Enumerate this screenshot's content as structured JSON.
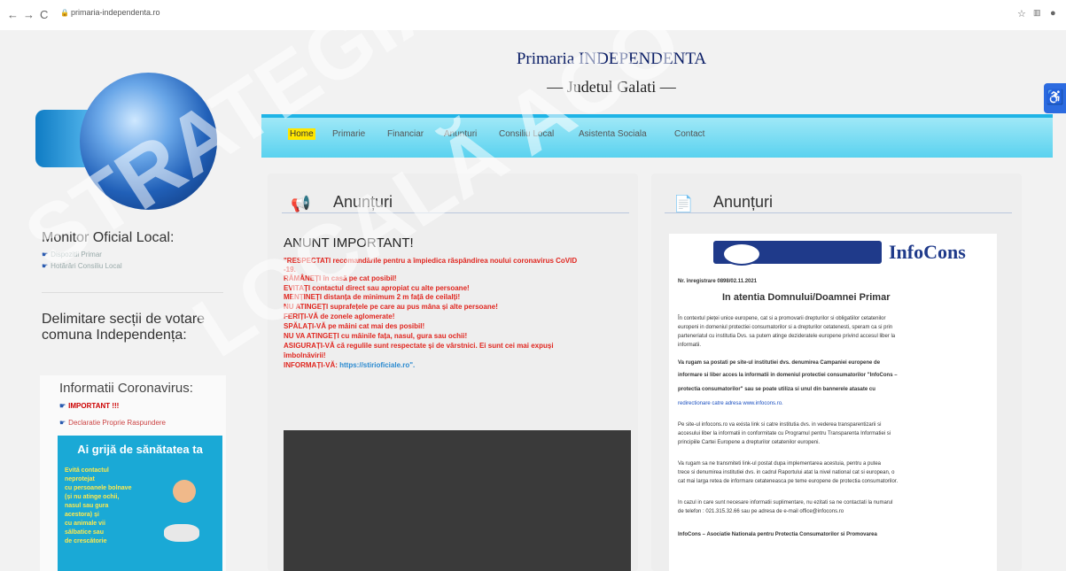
{
  "browser": {
    "url": "primaria-independenta.ro",
    "back": "←",
    "forward": "→",
    "reload": "C"
  },
  "header": {
    "title": "Primaria INDEPENDENTA",
    "subtitle": "–– Judetul Galati ––"
  },
  "nav": [
    "Home",
    "Primarie",
    "Financiar",
    "Anunturi",
    "Consiliu Local",
    "Asistenta Sociala",
    "Contact"
  ],
  "sidebar": {
    "monitor_title": "Monitor Oficial Local:",
    "monitor_links": [
      "Dispozitii Primar",
      "Hotărâri Consiliu Local"
    ],
    "vote_title_1": "Delimitare secții de votare",
    "vote_title_2": "comuna Independența:",
    "corona_title": "Informatii Coronavirus:",
    "corona_link1": "IMPORTANT !!!",
    "corona_link2": "Declaratie Proprie Raspundere",
    "health_title": "Ai grijă de sănătatea ta",
    "health_lines": [
      "Evită contactul",
      "neprotejat",
      "cu persoanele bolnave",
      "(și nu atinge ochii,",
      "nasul sau gura",
      "acestora) și",
      "cu animale vii",
      "sălbatice sau",
      "de crescătorie"
    ]
  },
  "panel_left": {
    "heading": "Anunțuri",
    "notice_title": "ANUNT IMPORTANT!",
    "lines": [
      "\"RESPECTATI recomandările pentru a împiedica răspândirea noului coronavirus CoVID",
      "-19.",
      "RĂMÂNEȚI în casă pe cat posibil!",
      "EVITAȚI contactul direct sau apropiat cu alte persoane!",
      "MENȚINEȚI distanța de minimum 2 m față de ceilalți!",
      "NU ATINGEȚI suprafețele pe care au pus mâna și alte persoane!",
      "FERIȚI-VĂ de zonele aglomerate!",
      "SPĂLAȚI-VĂ pe mâini cat mai des posibil!",
      "NU VA ATINGEȚI cu mâinile fața, nasul, gura sau ochii!",
      "ASIGURAȚI-VĂ că regulile sunt respectate și de vârstnici. Ei sunt cei mai expuși",
      "îmbolnăvirii!"
    ],
    "info_prefix": "INFORMAȚI-VĂ:",
    "info_link": "https://stirioficiale.ro\"."
  },
  "panel_right": {
    "heading": "Anunțuri",
    "doc_brand": "InfoCons",
    "doc_reg": "Nr. înregistrare 0898/02.11.2021",
    "doc_title": "In atentia Domnului/Doamnei Primar",
    "doc_paragraphs": [
      "În contextul pieței unice europene, cat si a promovarii drepturilor si obligatiilor cetatenilor",
      "europeni in domeniul protectiei consumatorilor si a drepturilor cetatenesti, speram ca si prin",
      "parteneriatul cu institutia Dvs. sa putem atinge dezideratele europene privind accesul liber la",
      "informatii.",
      "Va rugam sa postati pe site-ul institutiei dvs. denumirea Campaniei europene de",
      "informare si liber acces la informatii in domeniul protectiei consumatorilor \"InfoCons –",
      "protectia consumatorilor\" sau se poate utiliza si unul din bannerele atasate cu",
      "redirectionare catre adresa www.infocons.ro.",
      "Pe site-ul infocons.ro va exista link si catre institutia dvs. in vederea transparentizarii si",
      "accesului liber la informatii in conformitate cu Programul pentru Transparenta Informatiei si",
      "principiile Cartei Europene a drepturilor cetatenilor europeni.",
      "Va rugam sa ne transmiteti link-ul postat dupa implementarea acestuia, pentru a putea",
      "trece si denumirea institutiei dvs. in cadrul Raportului atat la nivel national cat si european, o",
      "cat mai larga retea de informare cetateneasca pe teme europene de protectia consumatorilor.",
      "In cazul in care sunt necesare informatii suplimentare, nu ezitati sa ne contactati la numarul",
      "de telefon : 021.315.32.66 sau pe adresa de e-mail office@infocons.ro",
      "InfoCons – Asociatie Nationala pentru Protectia Consumatorilor si Promovarea"
    ]
  },
  "watermark": {
    "line1": "STRATEGIA DE",
    "line2": "LOCALĂ ACO"
  },
  "colors": {
    "nav_gradient_top": "#9fe8f7",
    "nav_gradient_bottom": "#5ad2ef",
    "alert_red": "#e0261f",
    "title_blue": "#0b1e66"
  }
}
